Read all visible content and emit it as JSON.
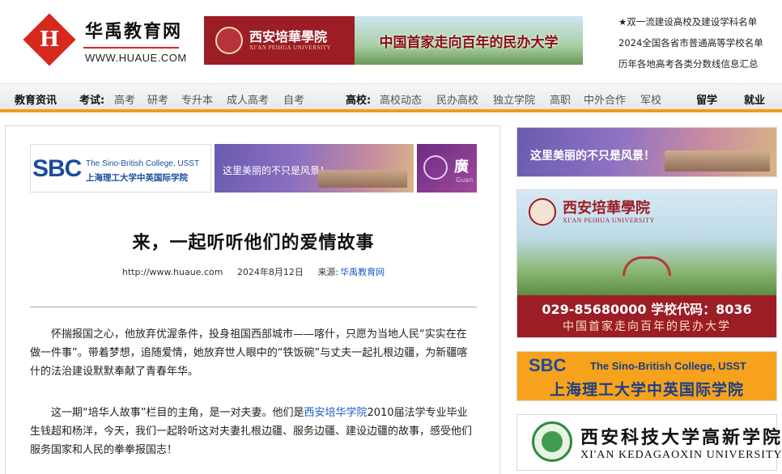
{
  "header": {
    "site_name": "华禹教育网",
    "site_domain": "WWW.HUAUE.COM",
    "logo_icon": "huaue-logo-icon",
    "logo_glyph": "H",
    "banner": {
      "school_name": "西安培華學院",
      "school_name_en": "XI'AN PEIHUA UNIVERSITY",
      "slogan": "中国首家走向百年的民办大学"
    },
    "links": [
      "★双一流建设高校及建设学科名单",
      "2024全国各省市普通高等学校名单",
      "历年各地高考各类分数线信息汇总"
    ]
  },
  "nav": {
    "news": "教育资讯",
    "exam_label": "考试:",
    "exam_items": [
      "高考",
      "研考",
      "专升本",
      "成人高考",
      "自考"
    ],
    "school_label": "高校:",
    "school_items": [
      "高校动态",
      "民办高校",
      "独立学院",
      "高职",
      "中外合作",
      "军校"
    ],
    "study_abroad": "留学",
    "employment": "就业"
  },
  "ads": {
    "sbc": {
      "logo": "SBC",
      "en": "The Sino-British College, USST",
      "cn": "上海理工大学中英国际学院"
    },
    "scenery": "这里美丽的不只是风景！",
    "third": {
      "text": "廣",
      "sub": "Guan"
    }
  },
  "article": {
    "title": "来，一起听听他们的爱情故事",
    "meta": {
      "url": "http://www.huaue.com",
      "date": "2024年8月12日",
      "source_label": "来源:",
      "source": "华禹教育网"
    },
    "p1": "怀揣报国之心，他放弃优渥条件，投身祖国西部城市——喀什，只愿为当地人民“实实在在做一件事”。带着梦想，追随爱情，她放弃世人眼中的“铁饭碗”与丈夫一起扎根边疆，为新疆喀什的法治建设默默奉献了青春年华。",
    "p2_before": "这一期“培华人故事”栏目的主角，是一对夫妻。他们是",
    "p2_link": "西安培华学院",
    "p2_after": "2010届法学专业毕业生钱超和杨洋，今天，我们一起聆听这对夫妻扎根边疆、服务边疆、建设边疆的故事，感受他们服务国家和人民的拳拳报国志！"
  },
  "sidebar": {
    "scenery": "这里美丽的不只是风景！",
    "peihua": {
      "name": "西安培華學院",
      "name_en": "XI'AN PEIHUA UNIVERSITY",
      "phone_line": "029-85680000   学校代码：8036",
      "motto": "中国首家走向百年的民办大学"
    },
    "sbc": {
      "logo": "SBC",
      "en": "The Sino-British College, USST",
      "cn": "上海理工大学中英国际学院"
    },
    "kedagaoxin": {
      "cn": "西安科技大学高新学院",
      "en": "XI'AN KEDAGAOXIN UNIVERSITY"
    }
  },
  "colors": {
    "brand_red": "#d7281d",
    "nav_orange": "#f39a1e",
    "link_blue": "#1a5ec4",
    "peihua_red": "#9c1d25"
  }
}
